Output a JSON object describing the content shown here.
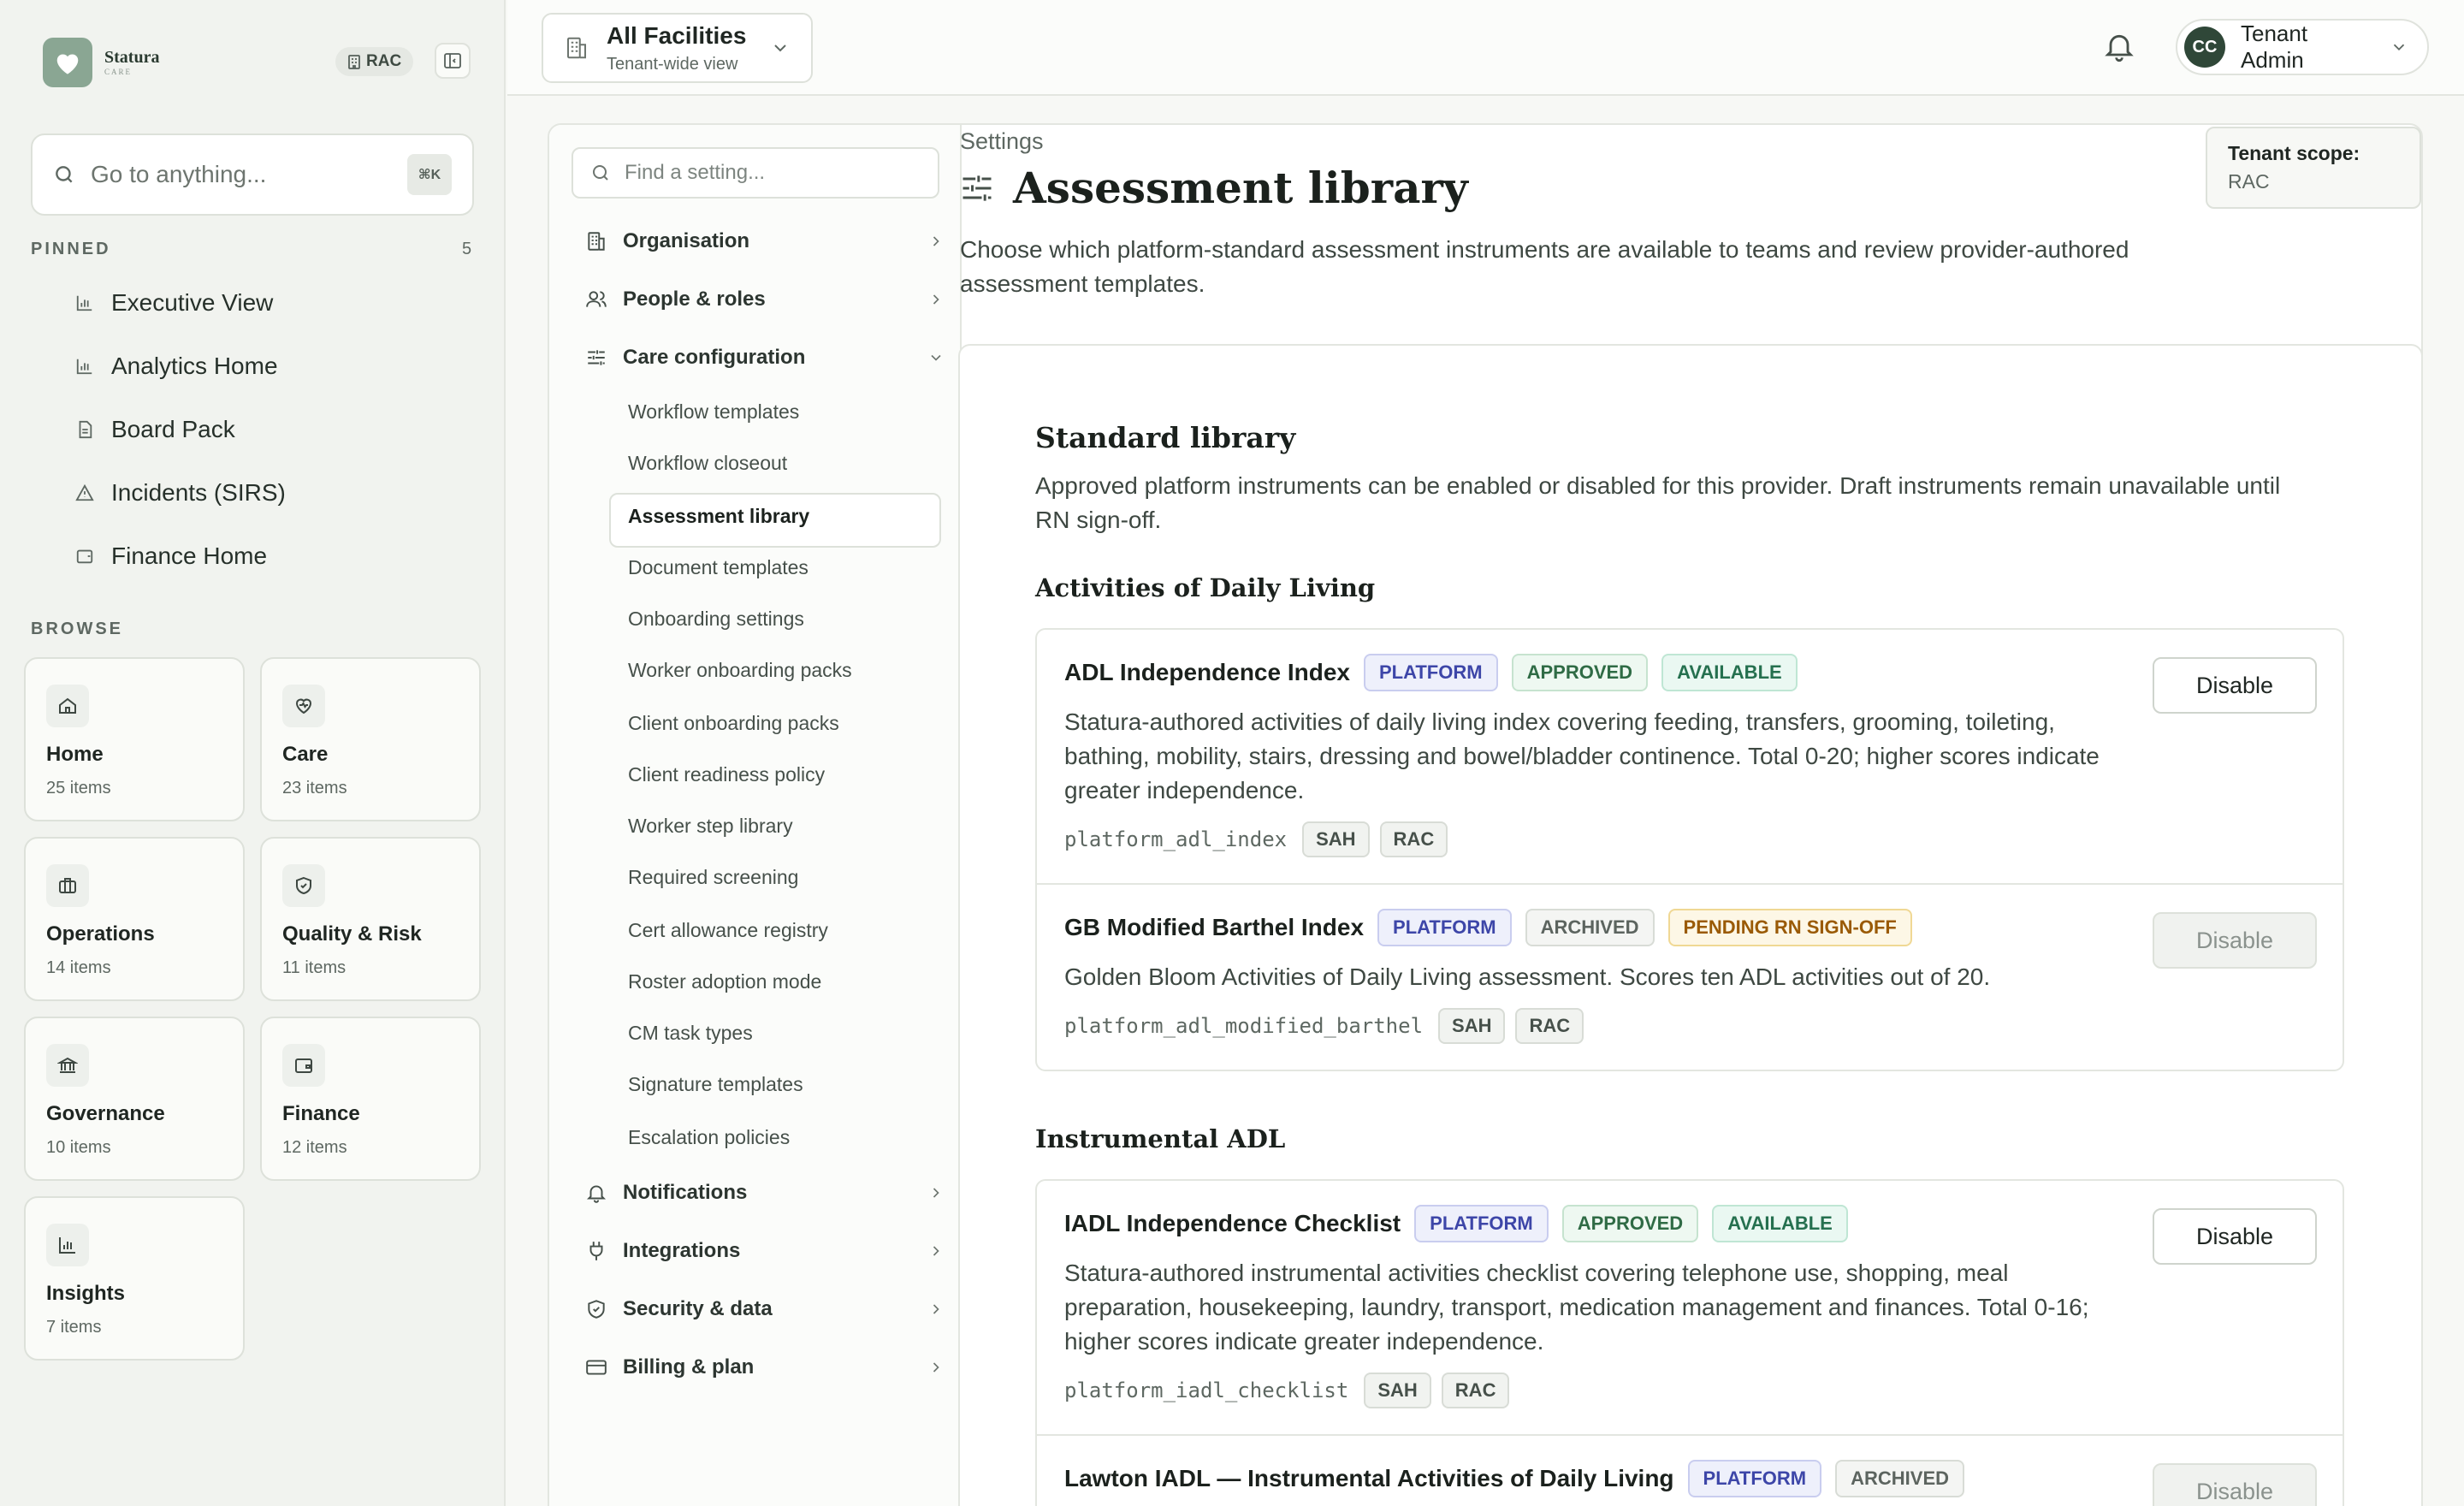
{
  "sidebar": {
    "brand": {
      "name": "Statura",
      "sub": "CARE"
    },
    "tenant_chip": "RAC",
    "search": {
      "placeholder": "Go to anything...",
      "shortcut": "⌘K"
    },
    "pinned_label": "PINNED",
    "pinned_count": "5",
    "pinned": [
      {
        "label": "Executive View",
        "icon": "bar-chart-icon"
      },
      {
        "label": "Analytics Home",
        "icon": "bar-chart-icon"
      },
      {
        "label": "Board Pack",
        "icon": "document-icon"
      },
      {
        "label": "Incidents (SIRS)",
        "icon": "warning-icon"
      },
      {
        "label": "Finance Home",
        "icon": "wallet-icon"
      }
    ],
    "browse_label": "BROWSE",
    "browse": [
      {
        "title": "Home",
        "count": "25 items",
        "icon": "home-icon"
      },
      {
        "title": "Care",
        "count": "23 items",
        "icon": "heart-pulse-icon"
      },
      {
        "title": "Operations",
        "count": "14 items",
        "icon": "briefcase-icon"
      },
      {
        "title": "Quality & Risk",
        "count": "11 items",
        "icon": "shield-check-icon"
      },
      {
        "title": "Governance",
        "count": "10 items",
        "icon": "landmark-icon"
      },
      {
        "title": "Finance",
        "count": "12 items",
        "icon": "wallet-icon"
      },
      {
        "title": "Insights",
        "count": "7 items",
        "icon": "bar-chart-icon"
      }
    ]
  },
  "topbar": {
    "facility": {
      "title": "All Facilities",
      "subtitle": "Tenant-wide view"
    },
    "user": {
      "initials": "CC",
      "name": "Tenant Admin"
    }
  },
  "settings_nav": {
    "search_placeholder": "Find a setting...",
    "categories": [
      {
        "label": "Organisation",
        "icon": "building-icon"
      },
      {
        "label": "People & roles",
        "icon": "users-icon"
      },
      {
        "label": "Care configuration",
        "icon": "sliders-icon"
      },
      {
        "label": "Notifications",
        "icon": "bell-icon"
      },
      {
        "label": "Integrations",
        "icon": "plug-icon"
      },
      {
        "label": "Security & data",
        "icon": "shield-check-icon"
      },
      {
        "label": "Billing & plan",
        "icon": "credit-card-icon"
      }
    ],
    "care_items": [
      "Workflow templates",
      "Workflow closeout",
      "Assessment library",
      "Document templates",
      "Onboarding settings",
      "Worker onboarding packs",
      "Client onboarding packs",
      "Client readiness policy",
      "Worker step library",
      "Required screening",
      "Cert allowance registry",
      "Roster adoption mode",
      "CM task types",
      "Signature templates",
      "Escalation policies"
    ]
  },
  "page": {
    "breadcrumb": "Settings",
    "title": "Assessment library",
    "description": "Choose which platform-standard assessment instruments are available to teams and review provider-authored assessment templates.",
    "scope_label": "Tenant scope:",
    "scope_value": "RAC"
  },
  "library": {
    "title": "Standard library",
    "description": "Approved platform instruments can be enabled or disabled for this provider. Draft instruments remain unavailable until RN sign-off.",
    "groups": [
      {
        "title": "Activities of Daily Living",
        "items": [
          {
            "name": "ADL Independence Index",
            "badges": [
              "PLATFORM",
              "APPROVED",
              "AVAILABLE"
            ],
            "description": "Statura-authored activities of daily living index covering feeding, transfers, grooming, toileting, bathing, mobility, stairs, dressing and bowel/bladder continence. Total 0-20; higher scores indicate greater independence.",
            "code": "platform_adl_index",
            "tags": [
              "SAH",
              "RAC"
            ],
            "action": "Disable"
          },
          {
            "name": "GB Modified Barthel Index",
            "badges": [
              "PLATFORM",
              "ARCHIVED",
              "PENDING RN SIGN-OFF"
            ],
            "description": "Golden Bloom Activities of Daily Living assessment. Scores ten ADL activities out of 20.",
            "code": "platform_adl_modified_barthel",
            "tags": [
              "SAH",
              "RAC"
            ],
            "action": "Disable"
          }
        ]
      },
      {
        "title": "Instrumental ADL",
        "items": [
          {
            "name": "IADL Independence Checklist",
            "badges": [
              "PLATFORM",
              "APPROVED",
              "AVAILABLE"
            ],
            "description": "Statura-authored instrumental activities checklist covering telephone use, shopping, meal preparation, housekeeping, laundry, transport, medication management and finances. Total 0-16; higher scores indicate greater independence.",
            "code": "platform_iadl_checklist",
            "tags": [
              "SAH",
              "RAC"
            ],
            "action": "Disable"
          },
          {
            "name": "Lawton IADL — Instrumental Activities of Daily Living",
            "badges": [
              "PLATFORM",
              "ARCHIVED"
            ],
            "action": "Disable"
          }
        ]
      }
    ]
  }
}
